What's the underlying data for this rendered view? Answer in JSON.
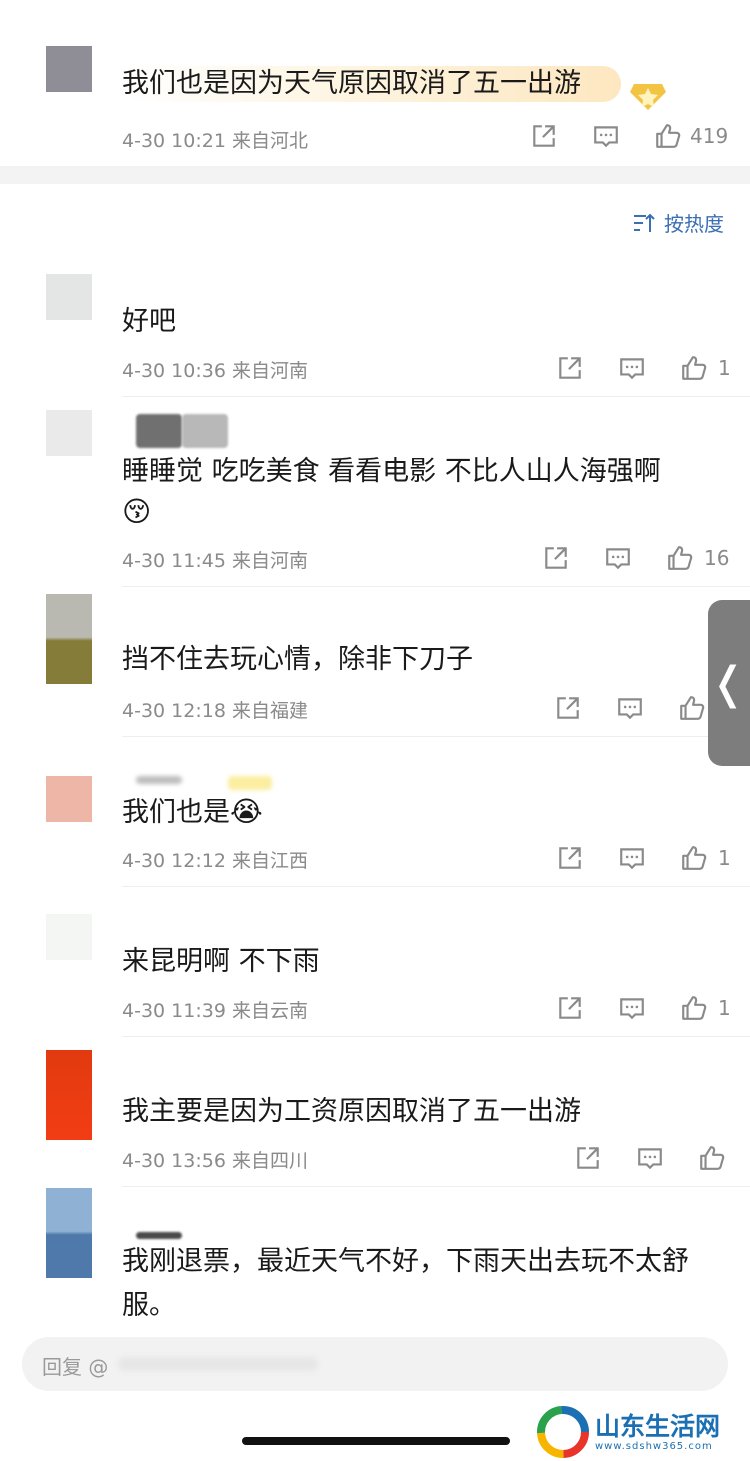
{
  "top_comment": {
    "text": "我们也是因为天气原因取消了五一出游",
    "meta": "4-30 10:21 来自河北",
    "likes": "419"
  },
  "sort": {
    "label": "按热度",
    "icon": "sort-icon"
  },
  "comments": [
    {
      "text": "好吧",
      "meta": "4-30 10:36 来自河南",
      "likes": "1",
      "avatar_color": "#e4e5e5"
    },
    {
      "text": "睡睡觉 吃吃美食  看看电影  不比人山人海强啊",
      "emoji": "😚",
      "meta": "4-30 11:45 来自河南",
      "likes": "16",
      "avatar_color": "#eaeaea"
    },
    {
      "text": "挡不住去玩心情，除非下刀子",
      "meta": "4-30 12:18 来自福建",
      "likes": "",
      "avatar_color": "#8a8139"
    },
    {
      "text": "我们也是",
      "emoji": "😭",
      "meta": "4-30 12:12 来自江西",
      "likes": "1",
      "avatar_color": "#eeb6a6"
    },
    {
      "text": "来昆明啊 不下雨",
      "meta": "4-30 11:39 来自云南",
      "likes": "1",
      "avatar_color": "#f6f8f6"
    },
    {
      "text": "我主要是因为工资原因取消了五一出游",
      "meta": "4-30 13:56 来自四川",
      "likes": "",
      "avatar_color": "#e53a12"
    },
    {
      "text": "我刚退票，最近天气不好，下雨天出去玩不太舒服。",
      "meta": "",
      "likes": "",
      "avatar_color": "#5f8fbf"
    }
  ],
  "reply_bar": {
    "placeholder": "回复 @"
  },
  "watermark": {
    "title": "山东生活网",
    "url": "www.sdshw365.com"
  },
  "icons": [
    "share-icon",
    "comment-icon",
    "like-icon",
    "chevron-left-icon",
    "medal-icon"
  ]
}
